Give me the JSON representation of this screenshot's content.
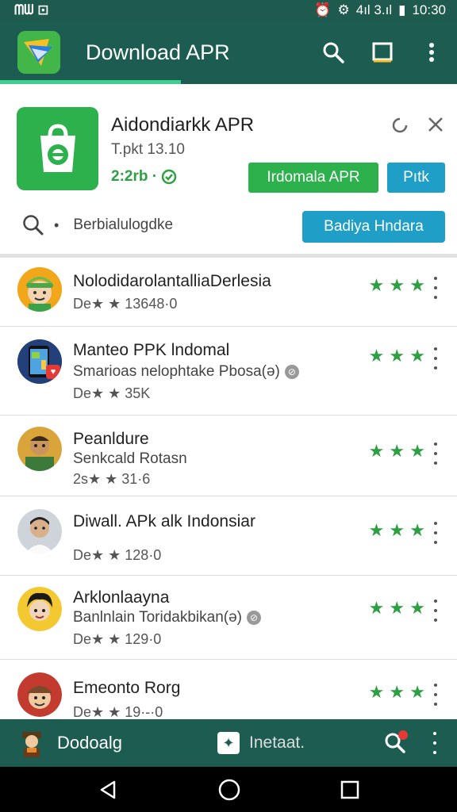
{
  "status_bar": {
    "left_text": "ᗰᗯ ⊡",
    "time": "10:30",
    "signal": "4ıl 3.ıl"
  },
  "app_bar": {
    "title": "Download APR"
  },
  "featured": {
    "name": "Aidondiarkk APR",
    "version": "T.pkt 13.10",
    "rating": "2:2rb ·",
    "install_label": "Irdomala APR",
    "pick_label": "Pıtk",
    "search_text": "Berbialulogdke",
    "popular_label": "Badiya Hndara"
  },
  "items": [
    {
      "title": "NolodidarolantalliaDerlesia",
      "sub": "",
      "meta": "De★ ★ 13648·0",
      "stars": "★ ★ ★"
    },
    {
      "title": "Manteo PPK lndomal",
      "sub": "Smarioas nelophtake Pbosa(ə)",
      "meta": "De★ ★ 35K",
      "stars": "★ ★ ★"
    },
    {
      "title": "Peanldure",
      "sub": "Senkcald Rotasn",
      "meta": "2s★ ★ 31·6",
      "stars": "★ ★ ★"
    },
    {
      "title": "Diwall. APk alk Indonsiar",
      "sub": "",
      "meta": "De★ ★ 128·0",
      "stars": "★ ★ ★"
    },
    {
      "title": "Arklonlaayna",
      "sub": "Banlnlain Toridakbikan(ə)",
      "meta": "De★ ★ 129·0",
      "stars": "★ ★ ★"
    },
    {
      "title": "Emeonto Rorg",
      "sub": "",
      "meta": "De★ ★ 19·-·0",
      "stars": "★ ★ ★"
    }
  ],
  "bottom_bar": {
    "left_label": "Dodoalg",
    "mid_label": "Inetaat."
  },
  "colors": {
    "primary": "#1d5c50",
    "accent_green": "#2db14c",
    "accent_blue": "#1f9ec7",
    "star_green": "#2ea043"
  }
}
